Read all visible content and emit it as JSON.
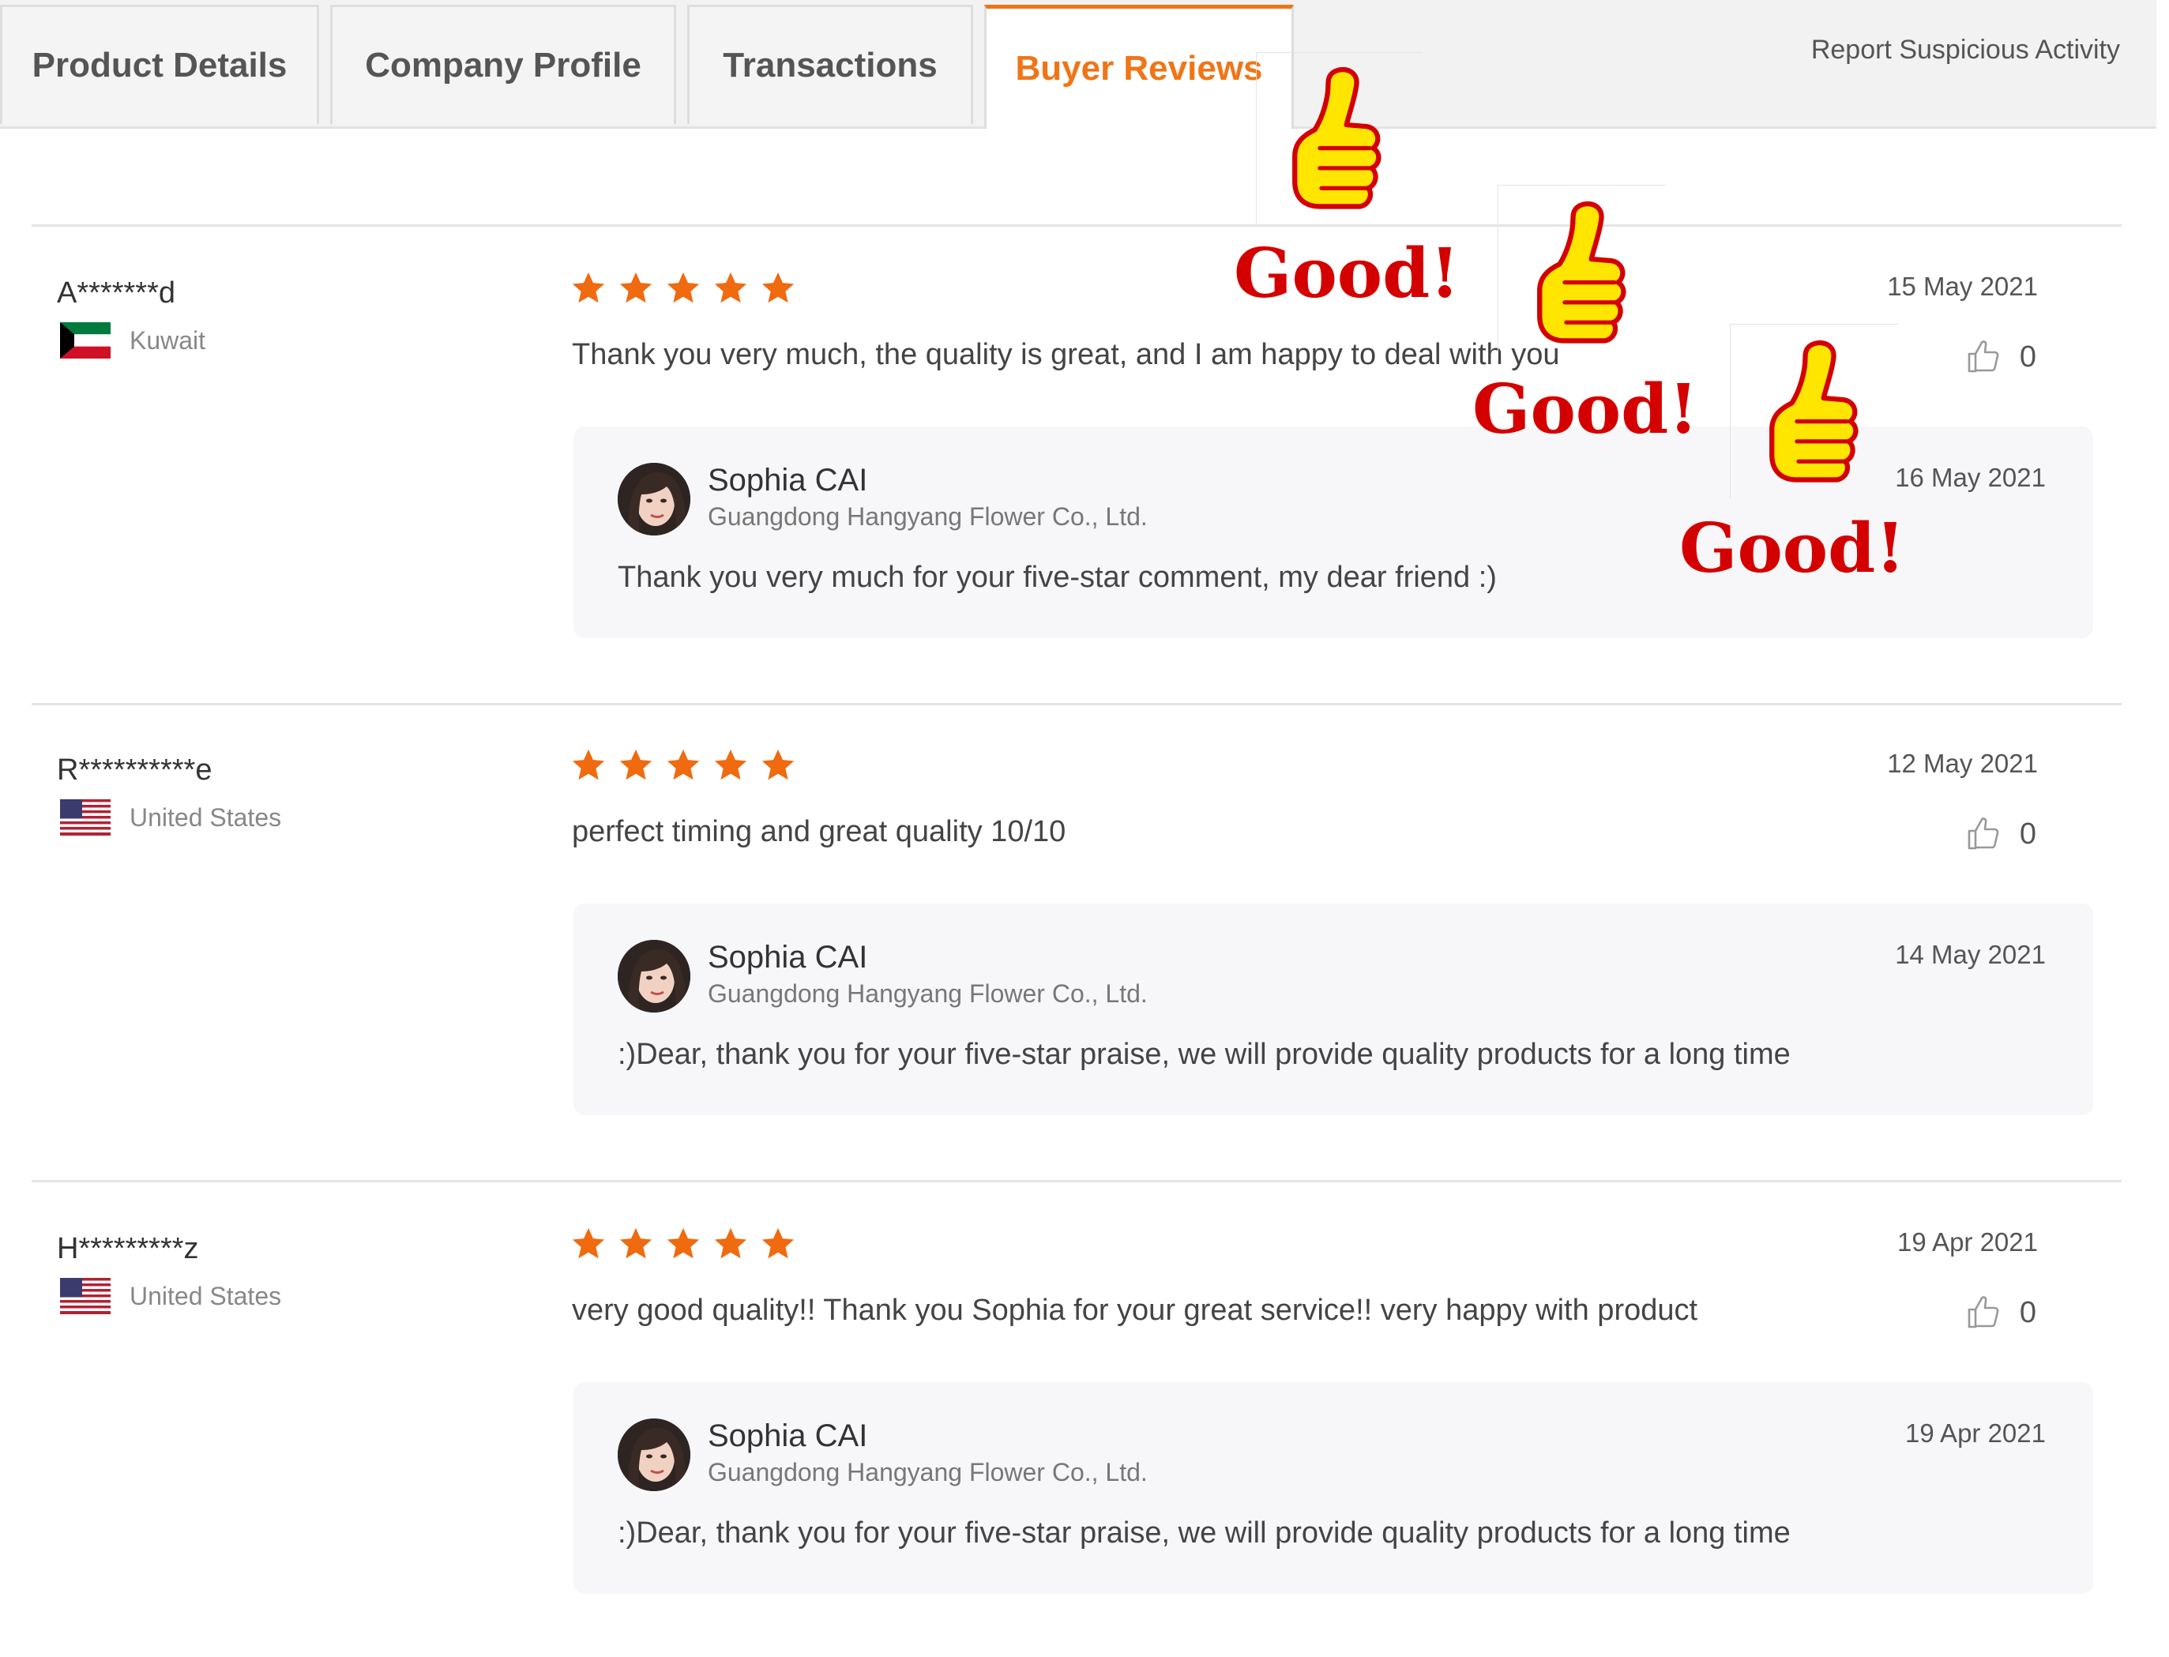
{
  "tabs": [
    {
      "label": "Product Details"
    },
    {
      "label": "Company Profile"
    },
    {
      "label": "Transactions"
    },
    {
      "label": "Buyer Reviews"
    }
  ],
  "report_link": "Report Suspicious Activity",
  "colors": {
    "accent": "#f07516",
    "star": "#f06a0f",
    "good_text": "#d40000",
    "thumb_fill": "#ffe600"
  },
  "stickers": {
    "text": "Good!",
    "icon": "thumbs-up-icon"
  },
  "reviews": [
    {
      "buyer": "A*******d",
      "country": "Kuwait",
      "flag": "kuwait-flag",
      "rating": 5,
      "text": "Thank you very much, the quality is great, and I am happy to deal with you",
      "date": "15 May 2021",
      "likes": "0",
      "reply": {
        "seller": "Sophia CAI",
        "company": "Guangdong Hangyang Flower Co., Ltd.",
        "date": "16 May 2021",
        "text": "Thank you very much for your five-star comment, my dear friend :)"
      }
    },
    {
      "buyer": "R**********e",
      "country": "United States",
      "flag": "us-flag",
      "rating": 5,
      "text": "perfect timing and great quality 10/10",
      "date": "12 May 2021",
      "likes": "0",
      "reply": {
        "seller": "Sophia CAI",
        "company": "Guangdong Hangyang Flower Co., Ltd.",
        "date": "14 May 2021",
        "text": ":)Dear, thank you for your five-star praise, we will provide quality products for a long time"
      }
    },
    {
      "buyer": "H*********z",
      "country": "United States",
      "flag": "us-flag",
      "rating": 5,
      "text": "very good quality!! Thank you Sophia for your great service!!  very happy with product",
      "date": "19 Apr 2021",
      "likes": "0",
      "reply": {
        "seller": "Sophia CAI",
        "company": "Guangdong Hangyang Flower Co., Ltd.",
        "date": "19 Apr 2021",
        "text": ":)Dear, thank you for your five-star praise, we will provide quality products for a long time"
      }
    }
  ]
}
